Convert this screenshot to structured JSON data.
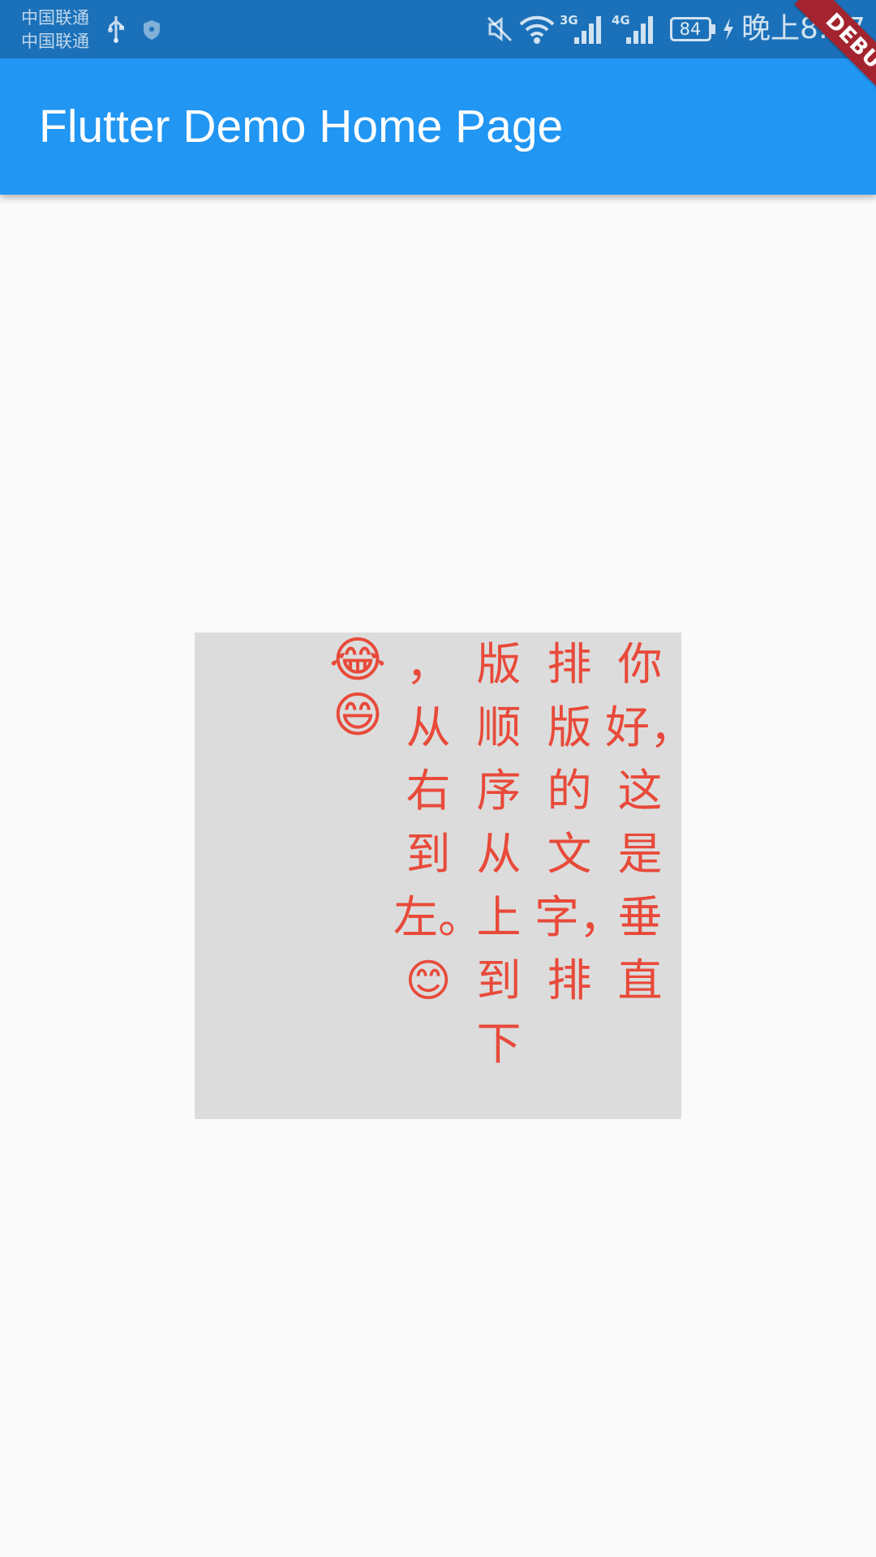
{
  "status_bar": {
    "carrier_1": "中国联通",
    "carrier_2": "中国联通",
    "network_1": "3G",
    "network_2": "4G",
    "battery": "84",
    "time": "晚上8:17"
  },
  "app_bar": {
    "title": "Flutter Demo Home Page"
  },
  "debug_banner": "DEBUG",
  "vertical_text": {
    "columns": [
      "你好，这是垂直",
      "排版的文字，排",
      "版顺序从上到下",
      "，从右到左。😊",
      "😂😄"
    ]
  },
  "colors": {
    "status_bar": "#1b71b9",
    "app_bar": "#2196f3",
    "background": "#fafafa",
    "text_box": "#dcdcdc",
    "text": "#e84a3a",
    "debug_banner": "#a3242e"
  }
}
